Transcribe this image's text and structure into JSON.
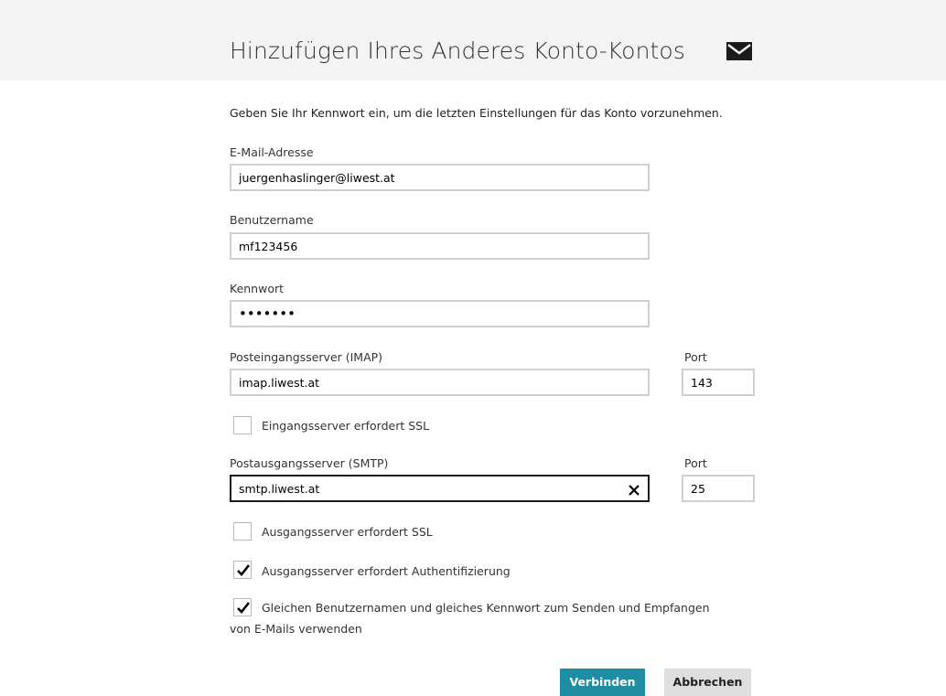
{
  "header": {
    "title": "Hinzufügen Ihres Anderes Konto-Kontos",
    "icon": "mail-icon"
  },
  "intro": "Geben Sie Ihr Kennwort ein, um die letzten Einstellungen für das Konto vorzunehmen.",
  "email": {
    "label": "E-Mail-Adresse",
    "value": "juergenhaslinger@liwest.at"
  },
  "username": {
    "label": "Benutzername",
    "value": "mf123456"
  },
  "password": {
    "label": "Kennwort",
    "value": "•••••••"
  },
  "incoming": {
    "label": "Posteingangsserver (IMAP)",
    "value": "imap.liwest.at",
    "port_label": "Port",
    "port": "143",
    "ssl_label": "Eingangsserver erfordert SSL",
    "ssl_checked": false
  },
  "outgoing": {
    "label": "Postausgangsserver (SMTP)",
    "value": "smtp.liwest.at",
    "port_label": "Port",
    "port": "25",
    "ssl_label": "Ausgangsserver erfordert SSL",
    "ssl_checked": false,
    "auth_label": "Ausgangsserver erfordert Authentifizierung",
    "auth_checked": true,
    "same_creds_label_line1": "Gleichen Benutzernamen und gleiches Kennwort zum Senden und Empfangen",
    "same_creds_label_line2": "von E-Mails verwenden",
    "same_creds_checked": true
  },
  "buttons": {
    "connect": "Verbinden",
    "cancel": "Abbrechen"
  },
  "colors": {
    "header_bg": "#f3f3f3",
    "primary_button": "#1f8ea3",
    "secondary_button": "#dedede"
  }
}
